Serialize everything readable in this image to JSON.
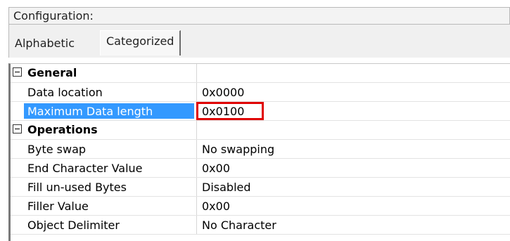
{
  "header": {
    "title": "Configuration:"
  },
  "tabs": [
    {
      "label": "Alphabetic",
      "active": false
    },
    {
      "label": "Categorized",
      "active": true
    }
  ],
  "grid": {
    "general": {
      "label": "General",
      "rows": [
        {
          "name": "Data location",
          "value": "0x0000"
        },
        {
          "name": "Maximum Data length",
          "value": "0x0100"
        }
      ]
    },
    "operations": {
      "label": "Operations",
      "rows": [
        {
          "name": "Byte swap",
          "value": "No swapping"
        },
        {
          "name": "End Character Value",
          "value": "0x00"
        },
        {
          "name": "Fill un-used Bytes",
          "value": "Disabled"
        },
        {
          "name": "Filler Value",
          "value": "0x00"
        },
        {
          "name": "Object Delimiter",
          "value": "No Character"
        }
      ]
    }
  },
  "colors": {
    "selection": "#3399ff",
    "highlight_border": "#e00000"
  }
}
